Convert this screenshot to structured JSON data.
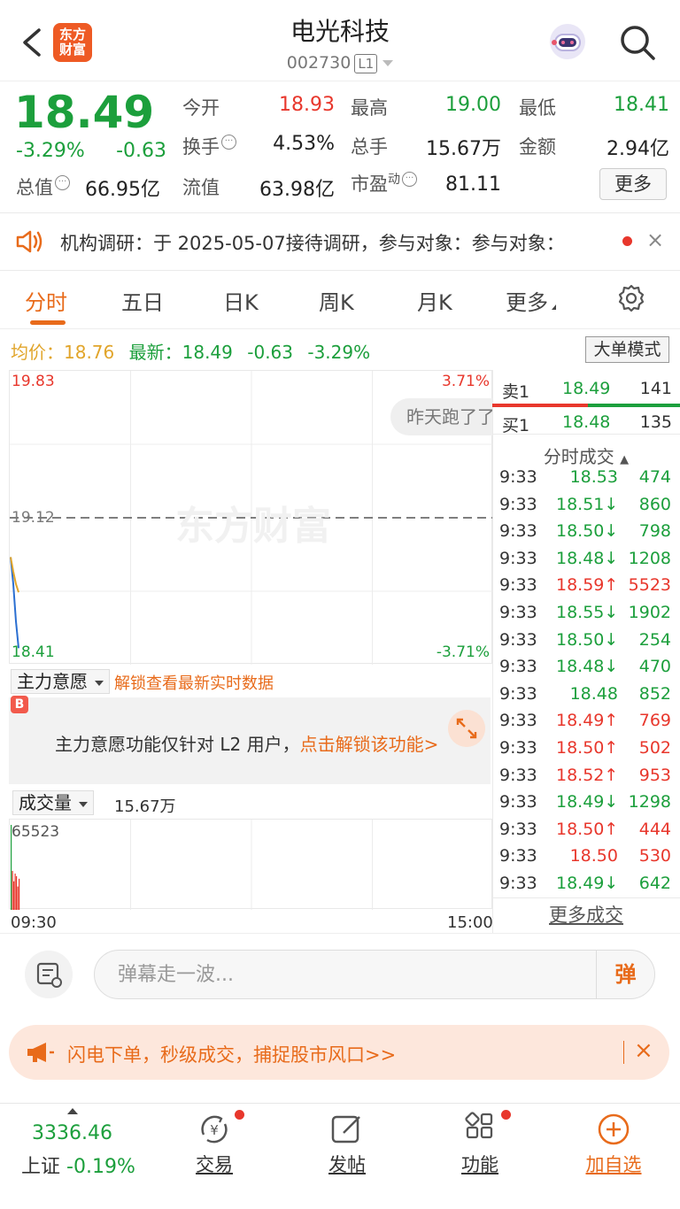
{
  "header": {
    "logo_line1": "东方",
    "logo_line2": "财富",
    "title": "电光科技",
    "code": "002730",
    "level_badge": "L1"
  },
  "quote": {
    "price": "18.49",
    "change_pct": "-3.29%",
    "change": "-0.63",
    "market_cap_label": "总值",
    "market_cap": "66.95亿",
    "open_label": "今开",
    "open": "18.93",
    "high_label": "最高",
    "high": "19.00",
    "low_label": "最低",
    "low": "18.41",
    "turnover_label": "换手",
    "turnover": "4.53%",
    "volume_label": "总手",
    "volume": "15.67万",
    "amount_label": "金额",
    "amount": "2.94亿",
    "float_label": "流值",
    "float_cap": "63.98亿",
    "pe_label": "市盈",
    "pe_sup": "动",
    "pe": "81.11",
    "more_label": "更多"
  },
  "notice": {
    "text": "机构调研：于 2025-05-07接待调研，参与对象：参与对象：",
    "close": "×"
  },
  "tabs": [
    "分时",
    "五日",
    "日K",
    "周K",
    "月K",
    "更多"
  ],
  "active_tab": 0,
  "chart_header": {
    "avg_label": "均价：",
    "avg": "18.76",
    "latest_label": "最新：",
    "latest": "18.49",
    "latest_chg": "-0.63",
    "latest_pct": "-3.29%",
    "mode_button": "大单模式"
  },
  "chart_data": {
    "type": "line",
    "title": "",
    "y_top": "19.83",
    "y_mid": "19.12",
    "y_bottom": "18.41",
    "pct_top": "3.71%",
    "pct_bottom": "-3.71%",
    "ylim": [
      18.41,
      19.83
    ],
    "prev_close": 19.12,
    "x_start": "09:30",
    "x_end": "15:00",
    "series": [
      {
        "values": [
          18.93,
          18.8,
          18.62,
          18.49
        ]
      },
      {
        "values": [
          18.93,
          18.86,
          18.8,
          18.76
        ]
      }
    ],
    "watermark": "东方财富"
  },
  "bubble_text": "昨天跑了了",
  "order_book": {
    "ask_label": "卖1",
    "ask_price": "18.49",
    "ask_vol": "141",
    "bid_label": "买1",
    "bid_price": "18.48",
    "bid_vol": "135",
    "ask_ratio": 0.51
  },
  "trades_title": "分时成交",
  "trades": [
    {
      "t": "9:33",
      "p": "18.53",
      "d": "",
      "v": "474",
      "c": "green"
    },
    {
      "t": "9:33",
      "p": "18.51",
      "d": "↓",
      "v": "860",
      "c": "green"
    },
    {
      "t": "9:33",
      "p": "18.50",
      "d": "↓",
      "v": "798",
      "c": "green"
    },
    {
      "t": "9:33",
      "p": "18.48",
      "d": "↓",
      "v": "1208",
      "c": "green"
    },
    {
      "t": "9:33",
      "p": "18.59",
      "d": "↑",
      "v": "5523",
      "c": "red"
    },
    {
      "t": "9:33",
      "p": "18.55",
      "d": "↓",
      "v": "1902",
      "c": "green"
    },
    {
      "t": "9:33",
      "p": "18.50",
      "d": "↓",
      "v": "254",
      "c": "green"
    },
    {
      "t": "9:33",
      "p": "18.48",
      "d": "↓",
      "v": "470",
      "c": "green"
    },
    {
      "t": "9:33",
      "p": "18.48",
      "d": "",
      "v": "852",
      "c": "green"
    },
    {
      "t": "9:33",
      "p": "18.49",
      "d": "↑",
      "v": "769",
      "c": "red"
    },
    {
      "t": "9:33",
      "p": "18.50",
      "d": "↑",
      "v": "502",
      "c": "red"
    },
    {
      "t": "9:33",
      "p": "18.52",
      "d": "↑",
      "v": "953",
      "c": "red"
    },
    {
      "t": "9:33",
      "p": "18.49",
      "d": "↓",
      "v": "1298",
      "c": "green"
    },
    {
      "t": "9:33",
      "p": "18.50",
      "d": "↑",
      "v": "444",
      "c": "red"
    },
    {
      "t": "9:33",
      "p": "18.50",
      "d": "",
      "v": "530",
      "c": "red"
    },
    {
      "t": "9:33",
      "p": "18.49",
      "d": "↓",
      "v": "642",
      "c": "green"
    }
  ],
  "more_trades": "更多成交",
  "main_force": {
    "label": "主力意愿",
    "unlock_text": "解锁查看最新实时数据",
    "badge": "B",
    "info_text": "主力意愿功能仅针对 L2 用户，",
    "info_link": "点击解锁该功能>"
  },
  "volume": {
    "label": "成交量",
    "total": "15.67万",
    "max_label": "65523",
    "bars": [
      65523,
      30000,
      22000,
      28000,
      26000,
      18000,
      24000
    ]
  },
  "time_start": "09:30",
  "time_end": "15:00",
  "comment": {
    "placeholder": "弹幕走一波...",
    "send": "弹"
  },
  "promo": {
    "text": "闪电下单，秒级成交，捕捉股市风口>>",
    "close": "×"
  },
  "bottom_nav": {
    "index_value": "3336.46",
    "index_name": "上证",
    "index_pct": "-0.19%",
    "items": [
      "交易",
      "发帖",
      "功能",
      "加自选"
    ]
  },
  "colors": {
    "up": "#e8372c",
    "down": "#1c9f3c",
    "accent": "#e86b1b",
    "avg": "#e1a52b",
    "price_line": "#2b6fd1"
  }
}
